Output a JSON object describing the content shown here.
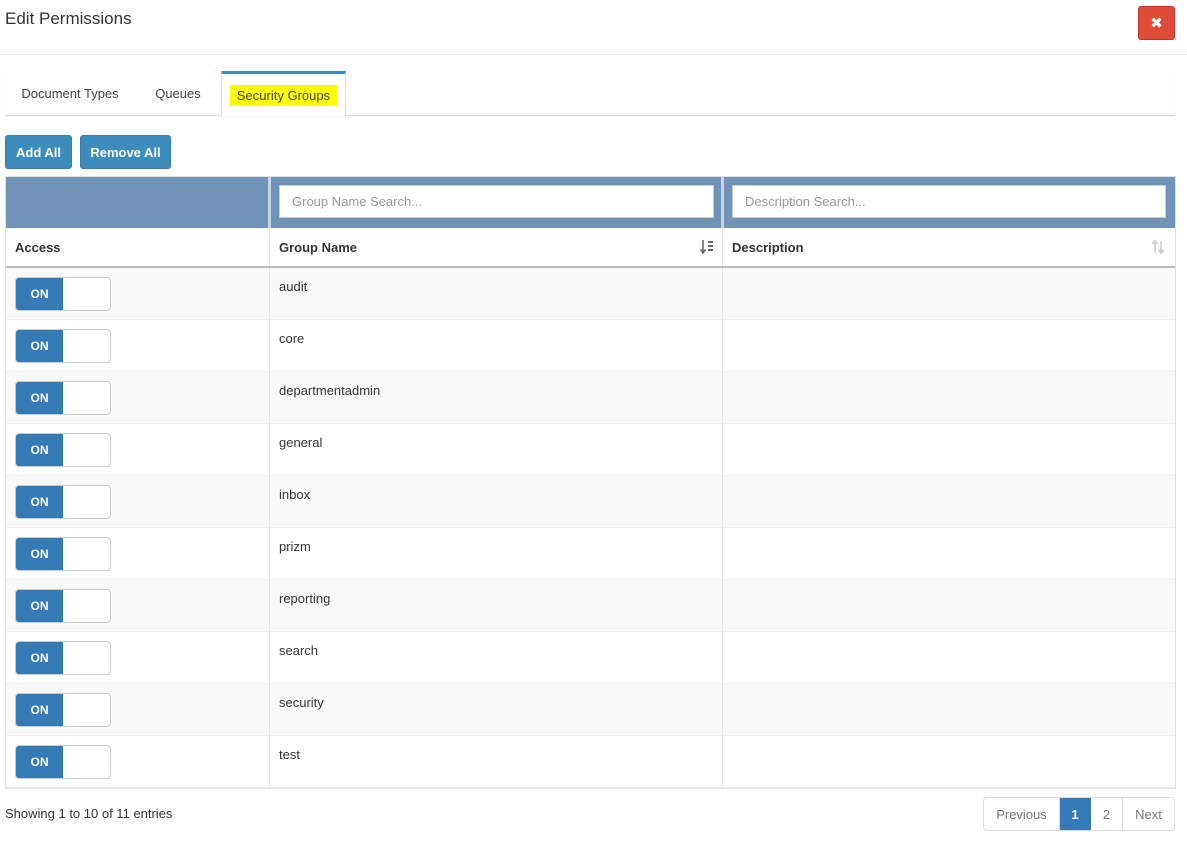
{
  "modal": {
    "title": "Edit Permissions",
    "close_icon": "close-icon"
  },
  "tabs": [
    {
      "label": "Document Types",
      "active": false
    },
    {
      "label": "Queues",
      "active": false
    },
    {
      "label": "Security Groups",
      "active": true
    }
  ],
  "toolbar": {
    "add_all_label": "Add All",
    "remove_all_label": "Remove All"
  },
  "search": {
    "group_name_placeholder": "Group Name Search...",
    "description_placeholder": "Description Search..."
  },
  "table": {
    "columns": [
      "Access",
      "Group Name",
      "Description"
    ],
    "sort_icons": {
      "group_name": "sort-alpha-asc-icon",
      "description": "sort-neutral-icon"
    },
    "rows": [
      {
        "access": "ON",
        "group_name": "audit",
        "description": ""
      },
      {
        "access": "ON",
        "group_name": "core",
        "description": ""
      },
      {
        "access": "ON",
        "group_name": "departmentadmin",
        "description": ""
      },
      {
        "access": "ON",
        "group_name": "general",
        "description": ""
      },
      {
        "access": "ON",
        "group_name": "inbox",
        "description": ""
      },
      {
        "access": "ON",
        "group_name": "prizm",
        "description": ""
      },
      {
        "access": "ON",
        "group_name": "reporting",
        "description": ""
      },
      {
        "access": "ON",
        "group_name": "search",
        "description": ""
      },
      {
        "access": "ON",
        "group_name": "security",
        "description": ""
      },
      {
        "access": "ON",
        "group_name": "test",
        "description": ""
      }
    ]
  },
  "footer": {
    "info": "Showing 1 to 10 of 11 entries",
    "pagination": {
      "previous": "Previous",
      "pages": [
        "1",
        "2"
      ],
      "current": "1",
      "next": "Next"
    }
  },
  "colors": {
    "primary": "#3c8dbc",
    "toggle_on": "#337ab7",
    "danger": "#dd4b39",
    "search_bar": "#7193b8",
    "highlight": "#ffff00"
  }
}
